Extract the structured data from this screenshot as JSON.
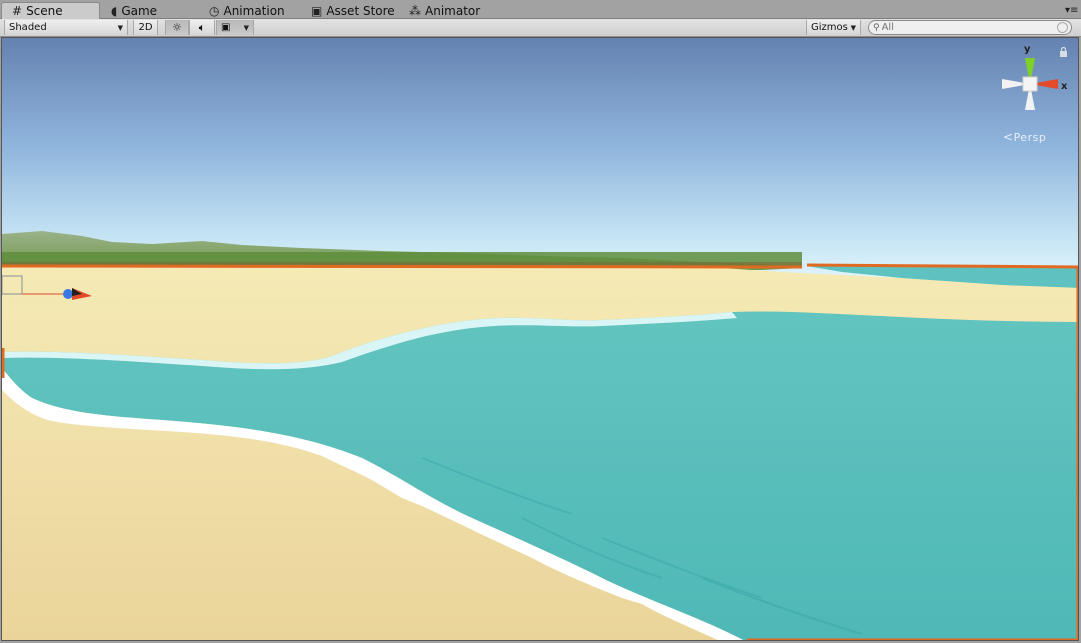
{
  "tabs": [
    {
      "label": "Scene",
      "icon": "scene-grid-icon",
      "active": true
    },
    {
      "label": "Game",
      "icon": "game-pacman-icon",
      "active": false
    },
    {
      "label": "Animation",
      "icon": "clock-icon",
      "active": false
    },
    {
      "label": "Asset Store",
      "icon": "shopping-bag-icon",
      "active": false
    },
    {
      "label": "Animator",
      "icon": "animator-nodes-icon",
      "active": false
    }
  ],
  "toolbar": {
    "draw_mode": "Shaded",
    "mode_2d": "2D",
    "gizmos": "Gizmos",
    "search_placeholder": "All"
  },
  "gizmo": {
    "y_label": "y",
    "x_label": "x",
    "projection": "Persp"
  },
  "colors": {
    "sky_top": "#6582b0",
    "sky_horizon": "#d8f0fb",
    "water": "#5bbfba",
    "sand": "#f3e5a9",
    "foam": "#ffffff",
    "selection_outline": "#e06a22",
    "axis_x": "#e14b2a",
    "axis_y": "#7fd12a"
  }
}
